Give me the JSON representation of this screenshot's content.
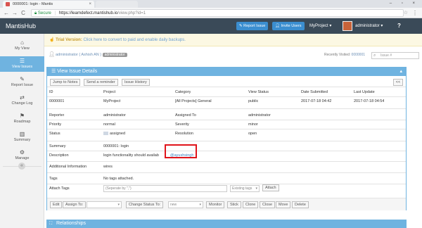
{
  "browser": {
    "tab_title": "0000001: login - Mantis",
    "tab_close": "×",
    "window_controls": "– ▫ ×",
    "back": "←",
    "forward": "→",
    "reload": "C",
    "secure_label": "Secure",
    "url_host": "https://learndefect.mantishub.io",
    "url_path": "/view.php?id=1"
  },
  "navbar": {
    "brand": "MantisHub",
    "report_issue": "Report Issue",
    "invite_users": "Invite Users",
    "project": "MyProject ▾",
    "username": "administrator ▾",
    "help": "?"
  },
  "sidebar": {
    "items": [
      {
        "label": "My View",
        "icon": "⌂"
      },
      {
        "label": "View Issues",
        "icon": "☰"
      },
      {
        "label": "Report Issue",
        "icon": "✎"
      },
      {
        "label": "Change Log",
        "icon": "⇄"
      },
      {
        "label": "Roadmap",
        "icon": "⚑"
      },
      {
        "label": "Summary",
        "icon": "▥"
      },
      {
        "label": "Manage",
        "icon": "⚙"
      }
    ],
    "collapse": "«"
  },
  "trial": {
    "icon": "☝",
    "label": "Trial Version:",
    "text": "Click here to convert to paid and enable daily backups."
  },
  "crumb": {
    "user": "administrator ( Ashish AN )",
    "role": "administrator",
    "recent_label": "Recently Visited:",
    "recent_id": "0000001",
    "search_placeholder": "Issue #"
  },
  "panel": {
    "title": "View Issue Details",
    "buttons": [
      "Jump to Notes",
      "Send a reminder",
      "Issue History"
    ],
    "expand": "<<",
    "columns": [
      "ID",
      "Project",
      "Category",
      "View Status",
      "Date Submitted",
      "Last Update"
    ],
    "row": [
      "0000001",
      "MyProject",
      "[All Projects] General",
      "public",
      "2017-07-18 04:42",
      "2017-07-18 04:54"
    ],
    "reporter_label": "Reporter",
    "reporter": "administrator",
    "assigned_label": "Assigned To",
    "assigned": "administrator",
    "priority_label": "Priority",
    "priority": "normal",
    "severity_label": "Severity",
    "severity": "minor",
    "status_label": "Status",
    "status": "assigned",
    "resolution_label": "Resolution",
    "resolution": "open",
    "summary_label": "Summary",
    "summary": "0000001: login",
    "description_label": "Description",
    "description": "login functionality should availab",
    "mention": "@ayushsingh",
    "additional_label": "Additional Information",
    "additional": "wires",
    "tags_label": "Tags",
    "tags": "No tags attached.",
    "attach_label": "Attach Tags",
    "attach_placeholder": "(Seperate by \",\")",
    "existing_tags": "Existing tags",
    "attach_button": "Attach",
    "actions": {
      "edit": "Edit",
      "assign": "Assign To:",
      "change_status": "Change Status To:",
      "status_select": "new",
      "monitor": "Monitor",
      "stick": "Stick",
      "clone": "Clone",
      "close": "Close",
      "move": "Move",
      "delete": "Delete"
    }
  },
  "relationships": {
    "title": "Relationships"
  }
}
